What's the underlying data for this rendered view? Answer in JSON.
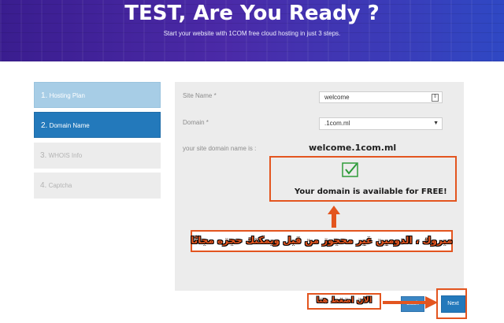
{
  "hero": {
    "title": "TEST, Are You Ready ?",
    "subtitle": "Start your website with 1COM free cloud hosting in just 3 steps."
  },
  "steps": [
    {
      "num": "1.",
      "label": "Hosting Plan",
      "state": "completed"
    },
    {
      "num": "2.",
      "label": "Domain Name",
      "state": "active"
    },
    {
      "num": "3.",
      "label": "WHOIS Info",
      "state": "disabled"
    },
    {
      "num": "4.",
      "label": "Captcha",
      "state": "disabled"
    }
  ],
  "form": {
    "site_name_label": "Site Name *",
    "site_name_value": "welcome",
    "domain_label": "Domain *",
    "domain_value": ".1com.ml",
    "result_label": "your site domain name is :",
    "result_value": "welcome.1com.ml"
  },
  "availability": {
    "message": "Your domain is available for FREE!",
    "icon": "checkmark-icon"
  },
  "annotations": {
    "arabic_note": "مبروك ، الدومين غير محجوز من قبل ويمكنك حجزه مجانًا",
    "arabic_click_here": "الان اضغط هنا"
  },
  "buttons": {
    "back": "Back",
    "next": "Next"
  },
  "colors": {
    "accent": "#2379bb",
    "highlight": "#e3551f",
    "check": "#2e9b3a"
  }
}
